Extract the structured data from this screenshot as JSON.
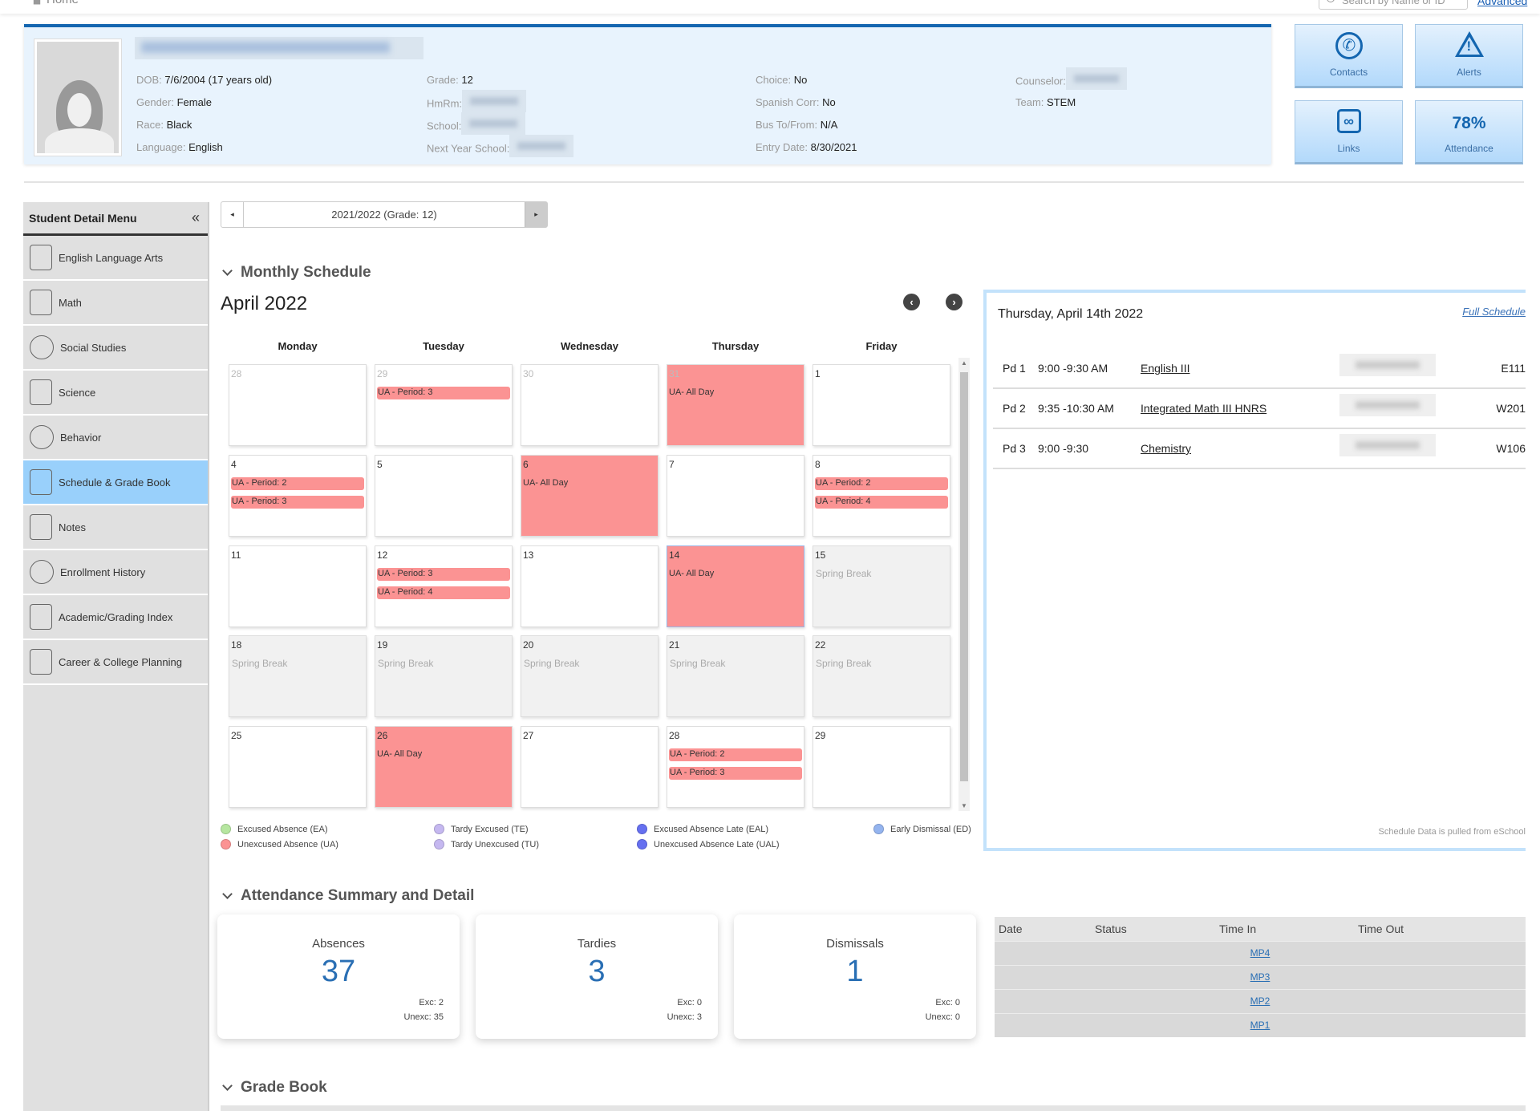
{
  "topbar": {
    "home_label": "Home",
    "search_placeholder": "Search by Name or ID",
    "advanced_label": "Advanced"
  },
  "student": {
    "name": "[redacted]",
    "fields": {
      "dob_label": "DOB:",
      "dob": "7/6/2004 (17 years old)",
      "gender_label": "Gender:",
      "gender": "Female",
      "race_label": "Race:",
      "race": "Black",
      "language_label": "Language:",
      "language": "English",
      "grade_label": "Grade:",
      "grade": "12",
      "hmrm_label": "HmRm:",
      "school_label": "School:",
      "next_school_label": "Next Year School:",
      "choice_label": "Choice:",
      "choice": "No",
      "spanish_label": "Spanish Corr:",
      "spanish": "No",
      "bus_label": "Bus To/From:",
      "bus": "N/A",
      "entry_label": "Entry Date:",
      "entry": "8/30/2021",
      "counselor_label": "Counselor:",
      "team_label": "Team:",
      "team": "STEM"
    }
  },
  "tiles": {
    "contacts": "Contacts",
    "alerts": "Alerts",
    "links": "Links",
    "attendance_value": "78%",
    "attendance_label": "Attendance"
  },
  "sidebar": {
    "title": "Student Detail Menu",
    "collapse_icon": "«",
    "items": [
      {
        "label": "English Language Arts",
        "icon": "book-icon"
      },
      {
        "label": "Math",
        "icon": "calculator-icon"
      },
      {
        "label": "Social Studies",
        "icon": "person-icon"
      },
      {
        "label": "Science",
        "icon": "flask-icon"
      },
      {
        "label": "Behavior",
        "icon": "head-gear-icon"
      },
      {
        "label": "Schedule & Grade Book",
        "icon": "calendar-icon",
        "active": true
      },
      {
        "label": "Notes",
        "icon": "notes-icon"
      },
      {
        "label": "Enrollment History",
        "icon": "history-icon"
      },
      {
        "label": "Academic/Grading Index",
        "icon": "notebook-icon"
      },
      {
        "label": "Career & College Planning",
        "icon": "graduate-icon"
      }
    ]
  },
  "year_selector": {
    "value": "2021/2022 (Grade: 12)",
    "prev": "◂",
    "next": "▸"
  },
  "monthly": {
    "section_title": "Monthly Schedule",
    "month": "April 2022",
    "prev": "‹",
    "next": "›",
    "days_of_week": [
      "Monday",
      "Tuesday",
      "Wednesday",
      "Thursday",
      "Friday"
    ],
    "weeks": [
      [
        {
          "num": "28",
          "other": true
        },
        {
          "num": "29",
          "other": true,
          "events": [
            "UA - Period: 3"
          ]
        },
        {
          "num": "30",
          "other": true
        },
        {
          "num": "31",
          "other": true,
          "allday": "UA- All Day"
        },
        {
          "num": "1"
        }
      ],
      [
        {
          "num": "4",
          "events": [
            "UA - Period: 2",
            "UA - Period: 3"
          ]
        },
        {
          "num": "5"
        },
        {
          "num": "6",
          "allday": "UA- All Day"
        },
        {
          "num": "7"
        },
        {
          "num": "8",
          "events": [
            "UA - Period: 2",
            "UA - Period: 4"
          ]
        }
      ],
      [
        {
          "num": "11"
        },
        {
          "num": "12",
          "events": [
            "UA - Period: 3",
            "UA - Period: 4"
          ]
        },
        {
          "num": "13"
        },
        {
          "num": "14",
          "allday": "UA- All Day",
          "selected": true
        },
        {
          "num": "15",
          "note": "Spring Break"
        }
      ],
      [
        {
          "num": "18",
          "note": "Spring Break"
        },
        {
          "num": "19",
          "note": "Spring Break"
        },
        {
          "num": "20",
          "note": "Spring Break"
        },
        {
          "num": "21",
          "note": "Spring Break"
        },
        {
          "num": "22",
          "note": "Spring Break"
        }
      ],
      [
        {
          "num": "25"
        },
        {
          "num": "26",
          "allday": "UA- All Day"
        },
        {
          "num": "27"
        },
        {
          "num": "28",
          "events": [
            "UA - Period: 2",
            "UA - Period: 3"
          ]
        },
        {
          "num": "29"
        }
      ]
    ],
    "legend": [
      {
        "label": "Excused Absence (EA)",
        "color": "#b6e6a0"
      },
      {
        "label": "Unexcused Absence (UA)",
        "color": "#fb9393"
      },
      {
        "label": "Tardy Excused (TE)",
        "color": "#c5b8f0"
      },
      {
        "label": "Tardy Unexcused (TU)",
        "color": "#c5b8f0"
      },
      {
        "label": "Excused Absence Late (EAL)",
        "color": "#6670f0"
      },
      {
        "label": "Unexcused Absence Late (UAL)",
        "color": "#6670f0"
      },
      {
        "label": "Early Dismissal (ED)",
        "color": "#94b4ef"
      }
    ]
  },
  "day_panel": {
    "title": "Thursday, April 14th 2022",
    "full_schedule": "Full Schedule",
    "periods": [
      {
        "pd": "Pd 1",
        "time": "9:00 -9:30 AM",
        "course": "English III",
        "room": "E111"
      },
      {
        "pd": "Pd 2",
        "time": "9:35 -10:30 AM",
        "course": "Integrated Math III HNRS",
        "room": "W201"
      },
      {
        "pd": "Pd 3",
        "time": "9:00 -9:30",
        "course": "Chemistry",
        "room": "W106"
      }
    ],
    "footer_note": "Schedule Data is pulled from eSchool"
  },
  "attendance": {
    "section_title": "Attendance Summary and Detail",
    "cards": [
      {
        "title": "Absences",
        "value": "37",
        "exc": "Exc: 2",
        "unexc": "Unexc: 35"
      },
      {
        "title": "Tardies",
        "value": "3",
        "exc": "Exc: 0",
        "unexc": "Unexc: 3"
      },
      {
        "title": "Dismissals",
        "value": "1",
        "exc": "Exc: 0",
        "unexc": "Unexc: 0"
      }
    ],
    "table": {
      "headers": [
        "Date",
        "Status",
        "Time In",
        "Time Out"
      ],
      "rows": [
        "MP4",
        "MP3",
        "MP2",
        "MP1"
      ]
    }
  },
  "gradebook": {
    "section_title": "Grade Book"
  },
  "colors": {
    "accent": "#1466b0",
    "ua": "#fb9393",
    "active_menu": "#99d0fb"
  }
}
